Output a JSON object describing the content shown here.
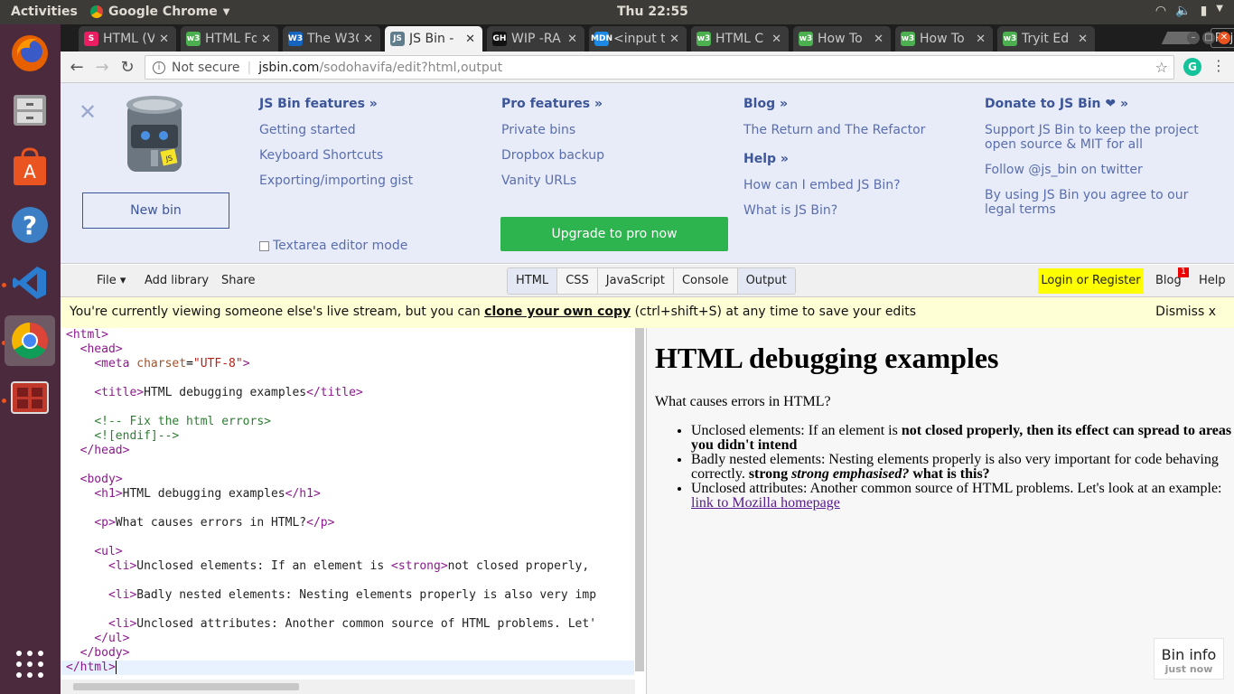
{
  "system": {
    "activities": "Activities",
    "app_name": "Google Chrome",
    "clock": "Thu 22:55"
  },
  "chrome": {
    "tabs": [
      {
        "title": "HTML (V",
        "favicon": "S",
        "color": "#e91e63"
      },
      {
        "title": "HTML Fo",
        "favicon": "w3",
        "color": "#4caf50"
      },
      {
        "title": "The W3C",
        "favicon": "W3",
        "color": "#1565c0"
      },
      {
        "title": "JS Bin -",
        "favicon": "JS",
        "color": "#607d8b",
        "active": true
      },
      {
        "title": "WIP -RA",
        "favicon": "GH",
        "color": "#111111"
      },
      {
        "title": "<input t",
        "favicon": "MDN",
        "color": "#1e88e5"
      },
      {
        "title": "HTML C",
        "favicon": "w3",
        "color": "#4caf50"
      },
      {
        "title": "How To",
        "favicon": "w3",
        "color": "#4caf50"
      },
      {
        "title": "How To",
        "favicon": "w3",
        "color": "#4caf50"
      },
      {
        "title": "Tryit Ed",
        "favicon": "w3",
        "color": "#4caf50"
      }
    ],
    "user": "Rajul",
    "not_secure": "Not secure",
    "url_domain": "jsbin.com",
    "url_path": "/sodohavifa/edit?html,output"
  },
  "jsbin": {
    "new_bin": "New bin",
    "features_heading": "JS Bin features »",
    "features_links": [
      "Getting started",
      "Keyboard Shortcuts",
      "Exporting/importing gist"
    ],
    "textarea_mode": "Textarea editor mode",
    "pro_heading": "Pro features »",
    "pro_links": [
      "Private bins",
      "Dropbox backup",
      "Vanity URLs"
    ],
    "upgrade": "Upgrade to pro now",
    "blog_heading": "Blog »",
    "blog_links": [
      "The Return and The Refactor"
    ],
    "help_heading": "Help »",
    "help_links": [
      "How can I embed JS Bin?",
      "What is JS Bin?"
    ],
    "donate_heading": "Donate to JS Bin ❤ »",
    "donate_links": [
      "Support JS Bin to keep the project open source & MIT for all",
      "Follow @js_bin on twitter",
      "By using JS Bin you agree to our legal terms"
    ],
    "controls": {
      "file": "File ▾",
      "add_library": "Add library",
      "share": "Share",
      "panels": [
        "HTML",
        "CSS",
        "JavaScript",
        "Console",
        "Output"
      ],
      "login": "Login or Register",
      "blog": "Blog",
      "blog_badge": "1",
      "help": "Help"
    },
    "banner": {
      "before": "You're currently viewing someone else's live stream, but you can ",
      "link": "clone your own copy",
      "after": " (ctrl+shift+S) at any time to save your edits",
      "dismiss": "Dismiss x"
    },
    "output": {
      "h1": "HTML debugging examples",
      "p": "What causes errors in HTML?",
      "li1_plain": "Unclosed elements: If an element is ",
      "li1_bold": "not closed properly, then its effect can spread to areas you didn't intend",
      "li2_plain": "Badly nested elements: Nesting elements properly is also very important for code behaving correctly. ",
      "li2_b1": "strong ",
      "li2_bi": "strong emphasised?",
      "li2_b2": " what is this?",
      "li3_plain": "Unclosed attributes: Another common source of HTML problems. Let's look at an example: ",
      "li3_link": "link to Mozilla homepage"
    },
    "bin_info": "Bin info",
    "bin_info_sub": "just now"
  }
}
